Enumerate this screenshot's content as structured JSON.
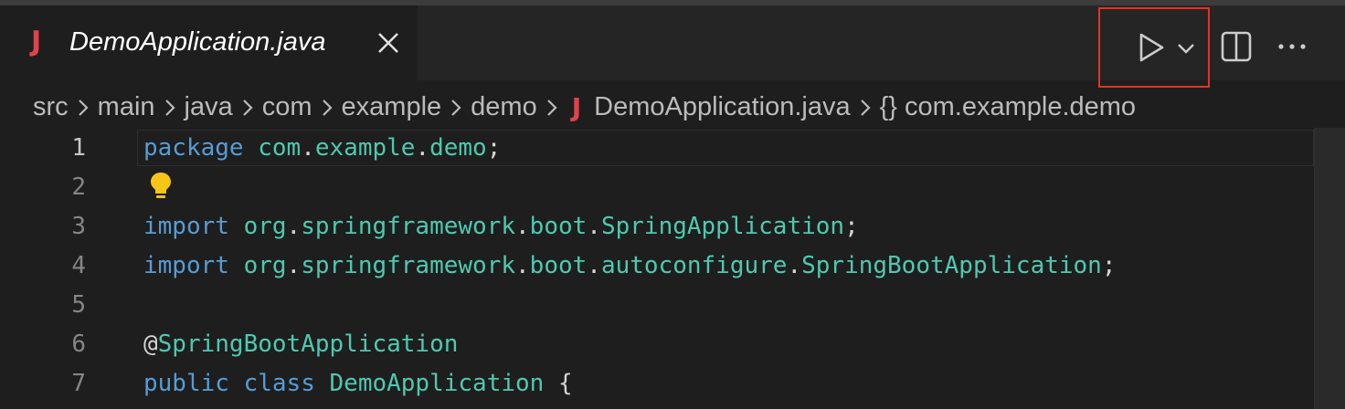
{
  "tab": {
    "icon_letter": "J",
    "title": "DemoApplication.java"
  },
  "toolbar": {
    "run_icon": "play-icon",
    "run_menu_icon": "chevron-down-icon",
    "split_icon": "split-editor-icon",
    "more_icon": "ellipsis-icon"
  },
  "breadcrumb": {
    "items": [
      "src",
      "main",
      "java",
      "com",
      "example",
      "demo"
    ],
    "file_icon_letter": "J",
    "file": "DemoApplication.java",
    "symbol_icon": "{}",
    "symbol": "com.example.demo"
  },
  "gutter": {
    "lines": [
      "1",
      "2",
      "3",
      "4",
      "5",
      "6",
      "7"
    ]
  },
  "code": {
    "line1": {
      "kw": "package",
      "p1": "com",
      "p2": "example",
      "p3": "demo"
    },
    "line3": {
      "kw": "import",
      "p1": "org",
      "p2": "springframework",
      "p3": "boot",
      "cls": "SpringApplication"
    },
    "line4": {
      "kw": "import",
      "p1": "org",
      "p2": "springframework",
      "p3": "boot",
      "p4": "autoconfigure",
      "cls": "SpringBootApplication"
    },
    "line6": {
      "at": "@",
      "annotation": "SpringBootApplication"
    },
    "line7": {
      "kw1": "public",
      "kw2": "class",
      "cls": "DemoApplication",
      "brace": "{"
    }
  },
  "colors": {
    "keyword": "#569cd6",
    "type": "#4ec9b0",
    "java_icon": "#e0434b",
    "highlight_box": "#e8321f"
  }
}
